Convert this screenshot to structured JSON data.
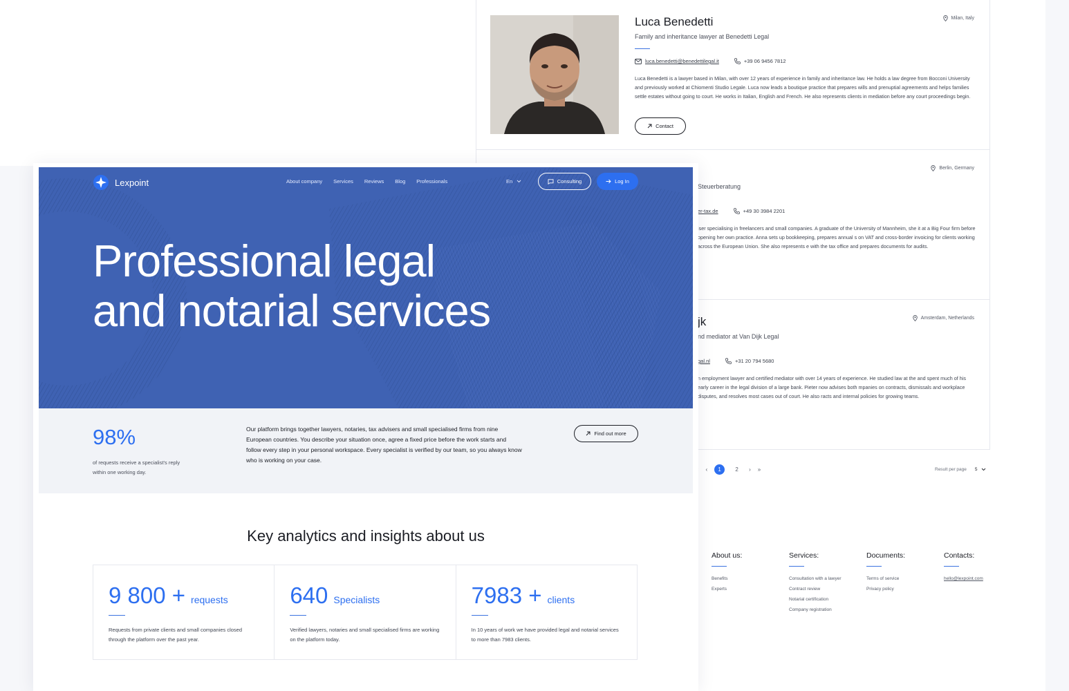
{
  "professionals": [
    {
      "name": "Luca Benedetti",
      "role": "Family and inheritance lawyer at Benedetti Legal",
      "location": "Milan, Italy",
      "email": "luca.benedetti@benedettilegal.it",
      "phone": "+39 06 9456 7812",
      "bio": "Luca Benedetti is a lawyer based in Milan, with over 12 years of experience in family and inheritance law. He holds a law degree from Bocconi University and previously worked at Chiomenti Studio Legale. Luca now leads a boutique practice that prepares wills and prenuptial agreements and helps families settle estates without going to court. He works in Italian, English and French. He also represents clients in mediation before any court proceedings begin.",
      "contact_label": "Contact"
    },
    {
      "name": "",
      "role": "Steuerberatung",
      "location": "Berlin, Germany",
      "email": "er-tax.de",
      "phone": "+49 30 3984 2201",
      "bio": "iser specialising in freelancers and small companies. A graduate of the University of Mannheim, she it at a Big Four firm before opening her own practice. Anna sets up bookkeeping, prepares annual s on VAT and cross-border invoicing for clients working across the European Union. She also represents e with the tax office and prepares documents for audits."
    },
    {
      "name": "jk",
      "role": "nd mediator at Van Dijk Legal",
      "location": "Amsterdam, Netherlands",
      "email": "gal.nl",
      "phone": "+31 20 794 5680",
      "bio": "n employment lawyer and certified mediator with over 14 years of experience. He studied law at the and spent much of his early career in the legal division of a large bank. Pieter now advises both mpanies on contracts, dismissals and workplace disputes, and resolves most cases out of court. He also racts and internal policies for growing teams."
    }
  ],
  "pagination": {
    "first": "«",
    "prev": "‹",
    "pages": [
      "1",
      "2"
    ],
    "next": "›",
    "last": "»",
    "results_label": "Result per page",
    "results_value": "5"
  },
  "footer": [
    {
      "title": "About us:",
      "links": [
        "Benefits",
        "Experts"
      ]
    },
    {
      "title": "Services:",
      "links": [
        "Consultation with a lawyer",
        "Contract review",
        "Notarial certification",
        "Company registration"
      ]
    },
    {
      "title": "Documents:",
      "links": [
        "Terms of service",
        "Privacy policy"
      ]
    },
    {
      "title": "Contacts:",
      "links": [
        "hello@lexpoint.com"
      ]
    }
  ],
  "nav": {
    "logo": "Lexpoint",
    "links": [
      "About company",
      "Services",
      "Reviews",
      "Blog",
      "Professionals"
    ],
    "lang": "En",
    "consulting": "Consulting",
    "login": "Log In"
  },
  "hero": {
    "title_line1": "Professional legal",
    "title_line2": "and notarial services"
  },
  "info": {
    "stat": "98%",
    "stat_caption": "of requests receive a specialist's reply within one working day.",
    "text": "Our platform brings together lawyers, notaries, tax advisers and small specialised firms from nine European countries. You describe your situation once, agree a fixed price before the work starts and follow every step in your personal workspace. Every specialist is verified by our team, so you always know who is working on your case.",
    "button": "Find out more"
  },
  "analytics": {
    "title": "Key analytics and insights about us",
    "cards": [
      {
        "number": "9 800 +",
        "unit": "requests",
        "desc": "Requests from private clients and small companies closed through the platform over the past year."
      },
      {
        "number": "640",
        "unit": "Specialists",
        "desc": "Verified lawyers, notaries and small specialised firms are working on the platform today."
      },
      {
        "number": "7983 +",
        "unit": "clients",
        "desc": "In 10 years of work we have provided legal and notarial services to more than 7983 clients."
      }
    ]
  },
  "colors": {
    "accent": "#2d6ff0",
    "hero_bg": "#3f62b3",
    "text": "#1b1d24"
  },
  "icons": [
    "location-pin-icon",
    "mail-icon",
    "phone-icon",
    "arrow-up-right-icon",
    "chat-icon",
    "arrow-right-icon",
    "chevron-down-icon",
    "logo-star-icon"
  ]
}
